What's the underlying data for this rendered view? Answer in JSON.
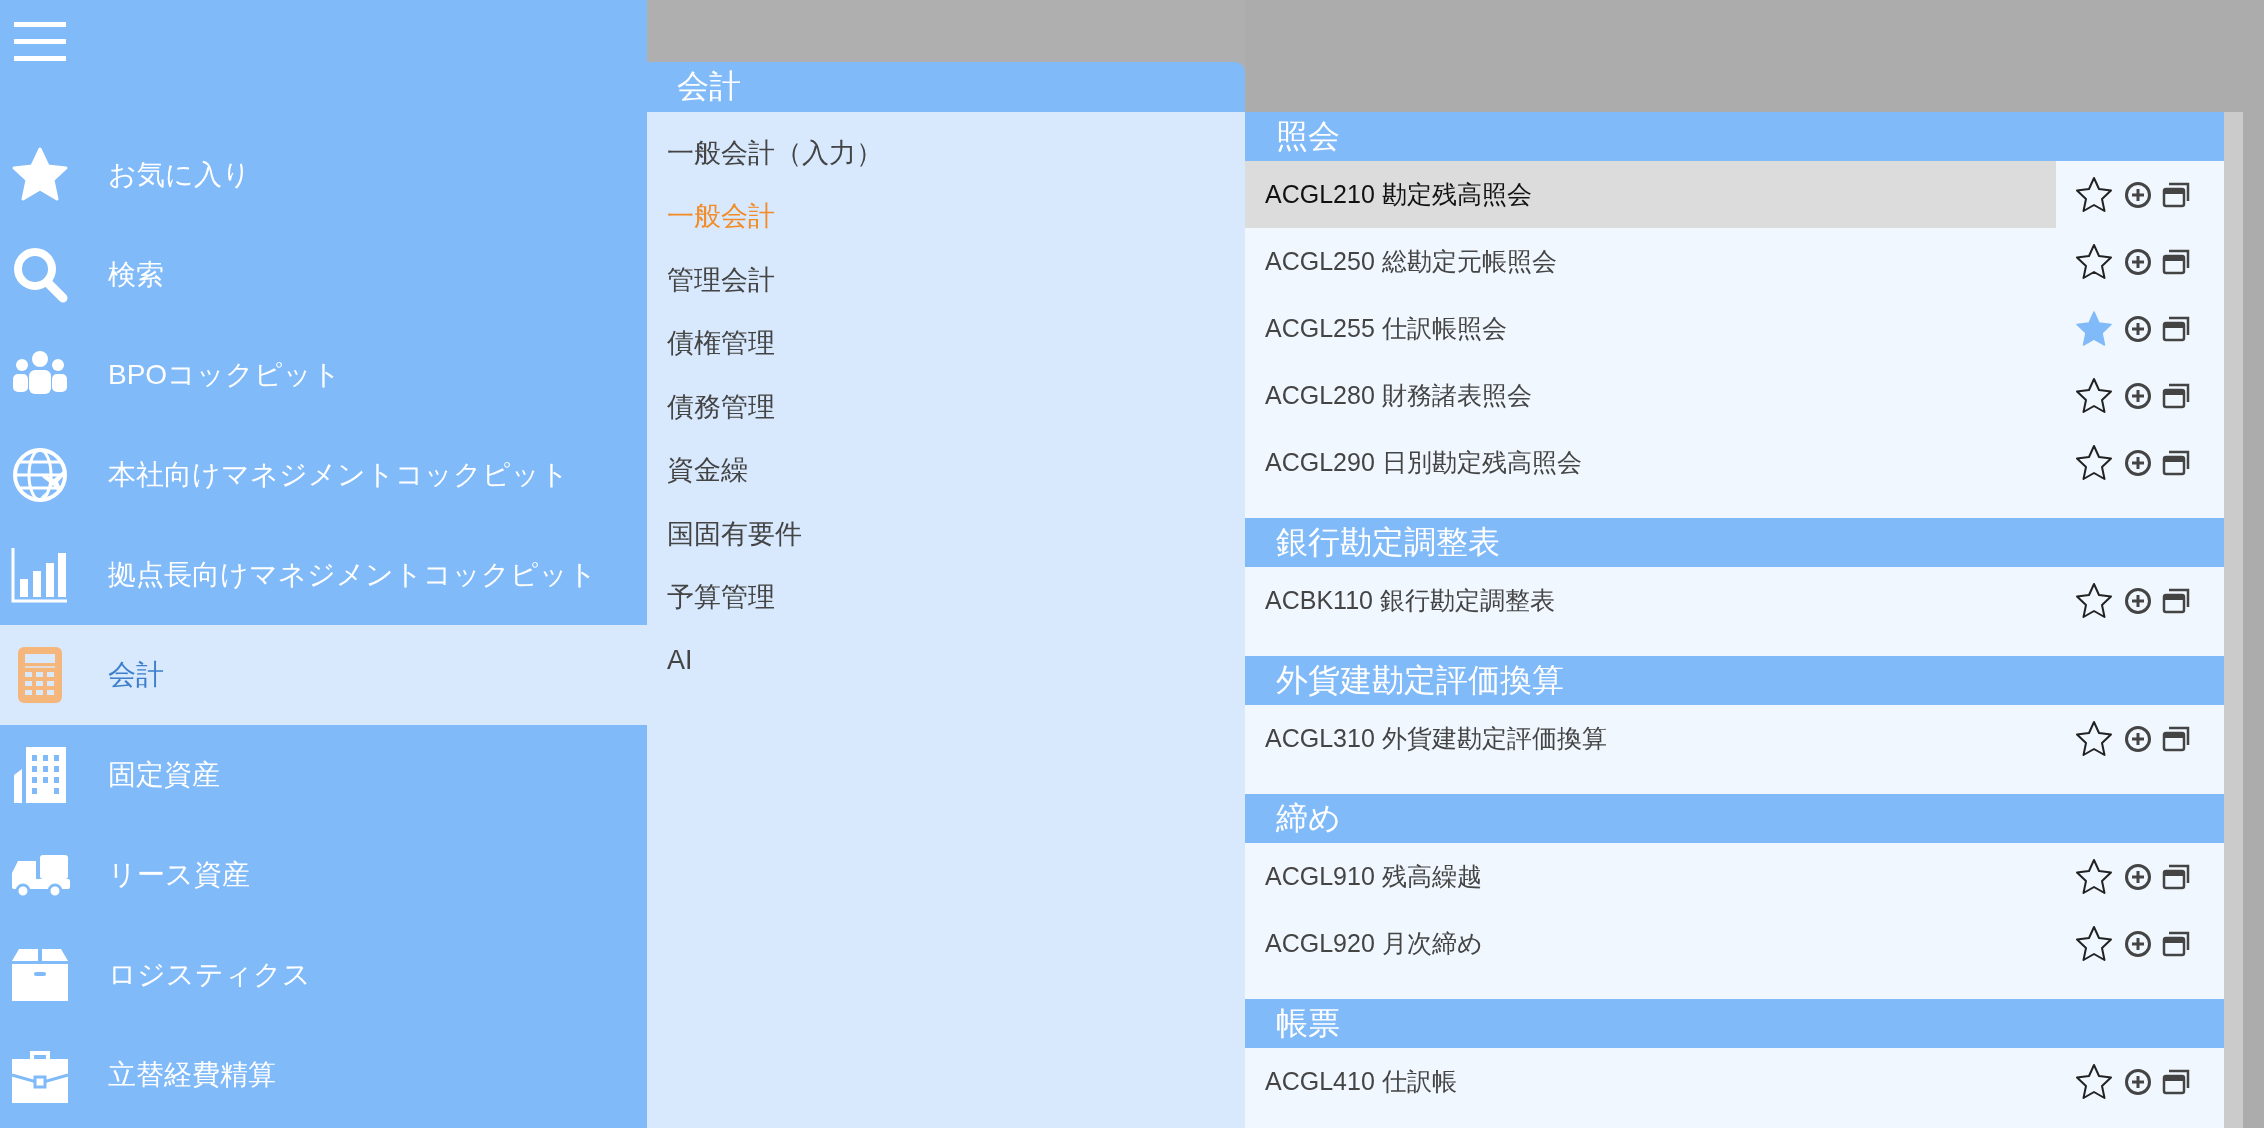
{
  "sidebar": {
    "items": [
      {
        "label": "お気に入り",
        "selected": false
      },
      {
        "label": "検索",
        "selected": false
      },
      {
        "label": "BPOコックピット",
        "selected": false
      },
      {
        "label": "本社向けマネジメントコックピット",
        "selected": false
      },
      {
        "label": "拠点長向けマネジメントコックピット",
        "selected": false
      },
      {
        "label": "会計",
        "selected": true
      },
      {
        "label": "固定資産",
        "selected": false
      },
      {
        "label": "リース資産",
        "selected": false
      },
      {
        "label": "ロジスティクス",
        "selected": false
      },
      {
        "label": "立替経費精算",
        "selected": false
      }
    ]
  },
  "submenu": {
    "title": "会計",
    "items": [
      {
        "label": "一般会計（入力）",
        "selected": false
      },
      {
        "label": "一般会計",
        "selected": true
      },
      {
        "label": "管理会計",
        "selected": false
      },
      {
        "label": "債権管理",
        "selected": false
      },
      {
        "label": "債務管理",
        "selected": false
      },
      {
        "label": "資金繰",
        "selected": false
      },
      {
        "label": "国固有要件",
        "selected": false
      },
      {
        "label": "予算管理",
        "selected": false
      },
      {
        "label": "AI",
        "selected": false
      }
    ]
  },
  "sections": [
    {
      "title": "照会",
      "rows": [
        {
          "label": "ACGL210 勘定残高照会",
          "favorite": false,
          "highlighted": true
        },
        {
          "label": "ACGL250 総勘定元帳照会",
          "favorite": false,
          "highlighted": false
        },
        {
          "label": "ACGL255 仕訳帳照会",
          "favorite": true,
          "highlighted": false
        },
        {
          "label": "ACGL280 財務諸表照会",
          "favorite": false,
          "highlighted": false
        },
        {
          "label": "ACGL290 日別勘定残高照会",
          "favorite": false,
          "highlighted": false
        }
      ]
    },
    {
      "title": "銀行勘定調整表",
      "rows": [
        {
          "label": "ACBK110 銀行勘定調整表",
          "favorite": false,
          "highlighted": false
        }
      ]
    },
    {
      "title": "外貨建勘定評価換算",
      "rows": [
        {
          "label": "ACGL310 外貨建勘定評価換算",
          "favorite": false,
          "highlighted": false
        }
      ]
    },
    {
      "title": "締め",
      "rows": [
        {
          "label": "ACGL910 残高繰越",
          "favorite": false,
          "highlighted": false
        },
        {
          "label": "ACGL920 月次締め",
          "favorite": false,
          "highlighted": false
        }
      ]
    },
    {
      "title": "帳票",
      "rows": [
        {
          "label": "ACGL410 仕訳帳",
          "favorite": false,
          "highlighted": false
        }
      ]
    }
  ]
}
